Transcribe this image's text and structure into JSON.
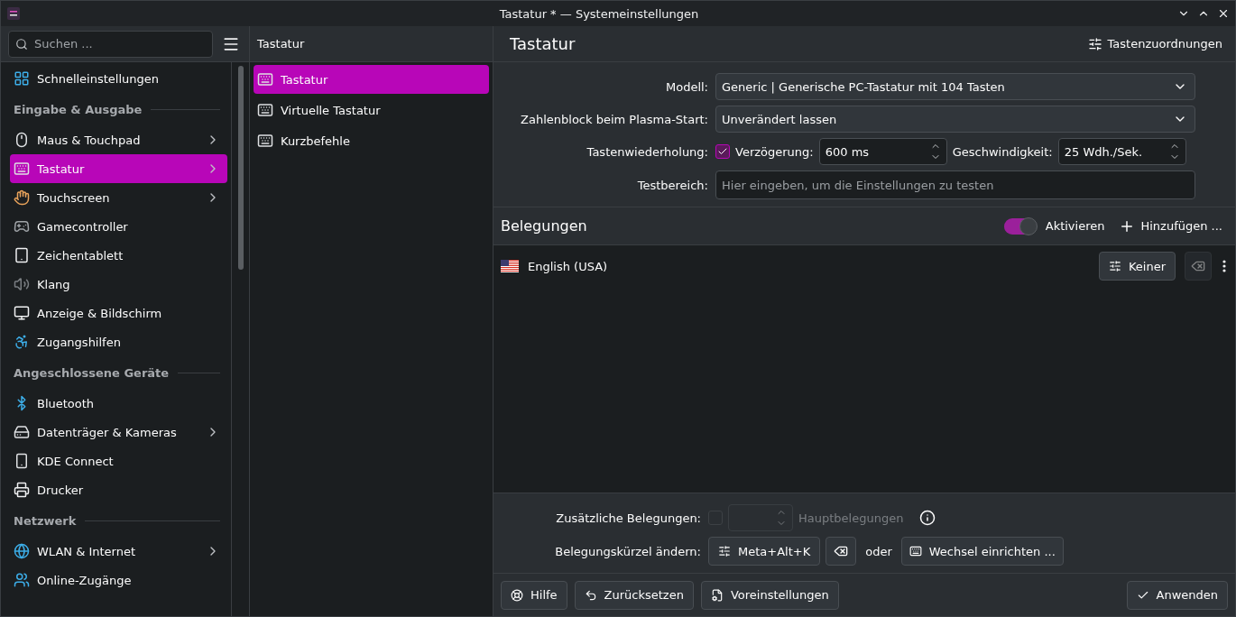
{
  "window": {
    "title": "Tastatur * — Systemeinstellungen"
  },
  "sidebar": {
    "search": {
      "placeholder": "Suchen ..."
    },
    "items": [
      {
        "kind": "item",
        "label": "Schnelleinstellungen",
        "has_children": false,
        "selected": false
      },
      {
        "kind": "header",
        "label": "Eingabe & Ausgabe"
      },
      {
        "kind": "item",
        "label": "Maus & Touchpad",
        "has_children": true,
        "selected": false
      },
      {
        "kind": "item",
        "label": "Tastatur",
        "has_children": true,
        "selected": true
      },
      {
        "kind": "item",
        "label": "Touchscreen",
        "has_children": true,
        "selected": false
      },
      {
        "kind": "item",
        "label": "Gamecontroller",
        "has_children": false,
        "selected": false
      },
      {
        "kind": "item",
        "label": "Zeichentablett",
        "has_children": false,
        "selected": false
      },
      {
        "kind": "item",
        "label": "Klang",
        "has_children": false,
        "selected": false
      },
      {
        "kind": "item",
        "label": "Anzeige & Bildschirm",
        "has_children": false,
        "selected": false
      },
      {
        "kind": "item",
        "label": "Zugangshilfen",
        "has_children": false,
        "selected": false
      },
      {
        "kind": "header",
        "label": "Angeschlossene Geräte"
      },
      {
        "kind": "item",
        "label": "Bluetooth",
        "has_children": false,
        "selected": false
      },
      {
        "kind": "item",
        "label": "Datenträger & Kameras",
        "has_children": true,
        "selected": false
      },
      {
        "kind": "item",
        "label": "KDE Connect",
        "has_children": false,
        "selected": false
      },
      {
        "kind": "item",
        "label": "Drucker",
        "has_children": false,
        "selected": false
      },
      {
        "kind": "header",
        "label": "Netzwerk"
      },
      {
        "kind": "item",
        "label": "WLAN & Internet",
        "has_children": true,
        "selected": false
      },
      {
        "kind": "item",
        "label": "Online-Zugänge",
        "has_children": false,
        "selected": false
      }
    ]
  },
  "subpages": {
    "title": "Tastatur",
    "items": [
      {
        "label": "Tastatur",
        "selected": true
      },
      {
        "label": "Virtuelle Tastatur",
        "selected": false
      },
      {
        "label": "Kurzbefehle",
        "selected": false
      }
    ]
  },
  "main": {
    "title": "Tastatur",
    "action": "Tastenzuordnungen",
    "model": {
      "label": "Modell:",
      "value": "Generic | Generische PC-Tastatur mit 104 Tasten"
    },
    "numlock": {
      "label": "Zahlenblock beim Plasma-Start:",
      "value": "Unverändert lassen"
    },
    "repeat": {
      "label": "Tastenwiederholung:",
      "checked": true,
      "delay_label": "Verzögerung:",
      "delay": "600 ms",
      "speed_label": "Geschwindigkeit:",
      "speed": "25 Wdh./Sek."
    },
    "test": {
      "label": "Testbereich:",
      "placeholder": "Hier eingeben, um die Einstellungen zu testen"
    },
    "layouts": {
      "title": "Belegungen",
      "toggle": {
        "label": "Aktivieren",
        "on": true
      },
      "add": "Hinzufügen ...",
      "rows": [
        {
          "name": "English (USA)",
          "shortcut": "Keiner"
        }
      ]
    },
    "extra": {
      "label": "Zusätzliche Belegungen:",
      "checked": false,
      "disabled": true,
      "suffix": "Hauptbelegungen"
    },
    "switch": {
      "label": "Belegungskürzel ändern:",
      "shortcut": "Meta+Alt+K",
      "or": "oder",
      "configure": "Wechsel einrichten ..."
    }
  },
  "footer": {
    "buttons": [
      {
        "kind": "help",
        "label": "Hilfe"
      },
      {
        "kind": "reset",
        "label": "Zurücksetzen"
      },
      {
        "kind": "defaults",
        "label": "Voreinstellungen"
      },
      {
        "kind": "apply",
        "label": "Anwenden"
      }
    ]
  }
}
